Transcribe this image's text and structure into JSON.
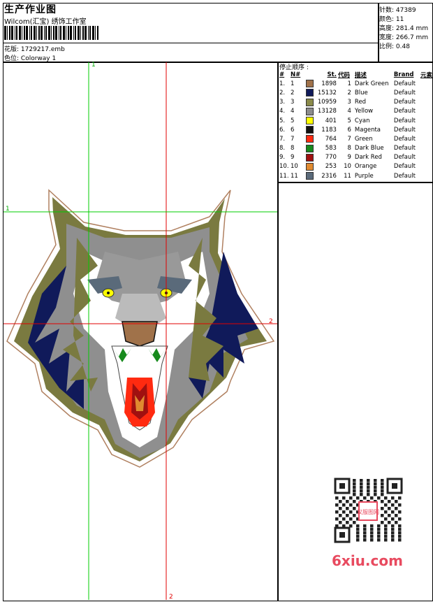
{
  "header": {
    "title": "生产作业图",
    "company": "Wilcom(汇宝) 绣饰工作室",
    "design_file_label": "花版:",
    "design_file": "1729217.emb",
    "colorway_label": "色位:",
    "colorway": "Colorway 1"
  },
  "stats": {
    "stitches_label": "针数:",
    "stitches": "47389",
    "colors_label": "颜色:",
    "colors": "11",
    "height_label": "高度:",
    "height": "281.4 mm",
    "width_label": "宽度:",
    "width": "266.7 mm",
    "scale_label": "比例:",
    "scale": "0.48"
  },
  "sequence": {
    "title": "停止顺序 :",
    "headers": [
      "#",
      "N#",
      "St.",
      "代码",
      "描述",
      "Brand",
      "元素"
    ],
    "rows": [
      {
        "n": "1.",
        "nn": "1",
        "color": "#a0724a",
        "st": "1898",
        "code": "1",
        "desc": "Dark Green",
        "brand": "Default"
      },
      {
        "n": "2.",
        "nn": "2",
        "color": "#101a5a",
        "st": "15132",
        "code": "2",
        "desc": "Blue",
        "brand": "Default"
      },
      {
        "n": "3.",
        "nn": "3",
        "color": "#8a8a4a",
        "st": "10959",
        "code": "3",
        "desc": "Red",
        "brand": "Default"
      },
      {
        "n": "4.",
        "nn": "4",
        "color": "#8c8c8c",
        "st": "13128",
        "code": "4",
        "desc": "Yellow",
        "brand": "Default"
      },
      {
        "n": "5.",
        "nn": "5",
        "color": "#ffff00",
        "st": "401",
        "code": "5",
        "desc": "Cyan",
        "brand": "Default"
      },
      {
        "n": "6.",
        "nn": "6",
        "color": "#111111",
        "st": "1183",
        "code": "6",
        "desc": "Magenta",
        "brand": "Default"
      },
      {
        "n": "7.",
        "nn": "7",
        "color": "#ff2a10",
        "st": "764",
        "code": "7",
        "desc": "Green",
        "brand": "Default"
      },
      {
        "n": "8.",
        "nn": "8",
        "color": "#168a1c",
        "st": "583",
        "code": "8",
        "desc": "Dark Blue",
        "brand": "Default"
      },
      {
        "n": "9.",
        "nn": "9",
        "color": "#a01010",
        "st": "770",
        "code": "9",
        "desc": "Dark Red",
        "brand": "Default"
      },
      {
        "n": "10.",
        "nn": "10",
        "color": "#e08a30",
        "st": "253",
        "code": "10",
        "desc": "Orange",
        "brand": "Default"
      },
      {
        "n": "11.",
        "nn": "11",
        "color": "#5a6a7a",
        "st": "2316",
        "code": "11",
        "desc": "Purple",
        "brand": "Default"
      }
    ]
  },
  "guides": {
    "v1": "1",
    "h1": "1",
    "h2": "2",
    "v2": "2"
  },
  "watermark": "6xiu.com",
  "seal_text": "汉服图网"
}
